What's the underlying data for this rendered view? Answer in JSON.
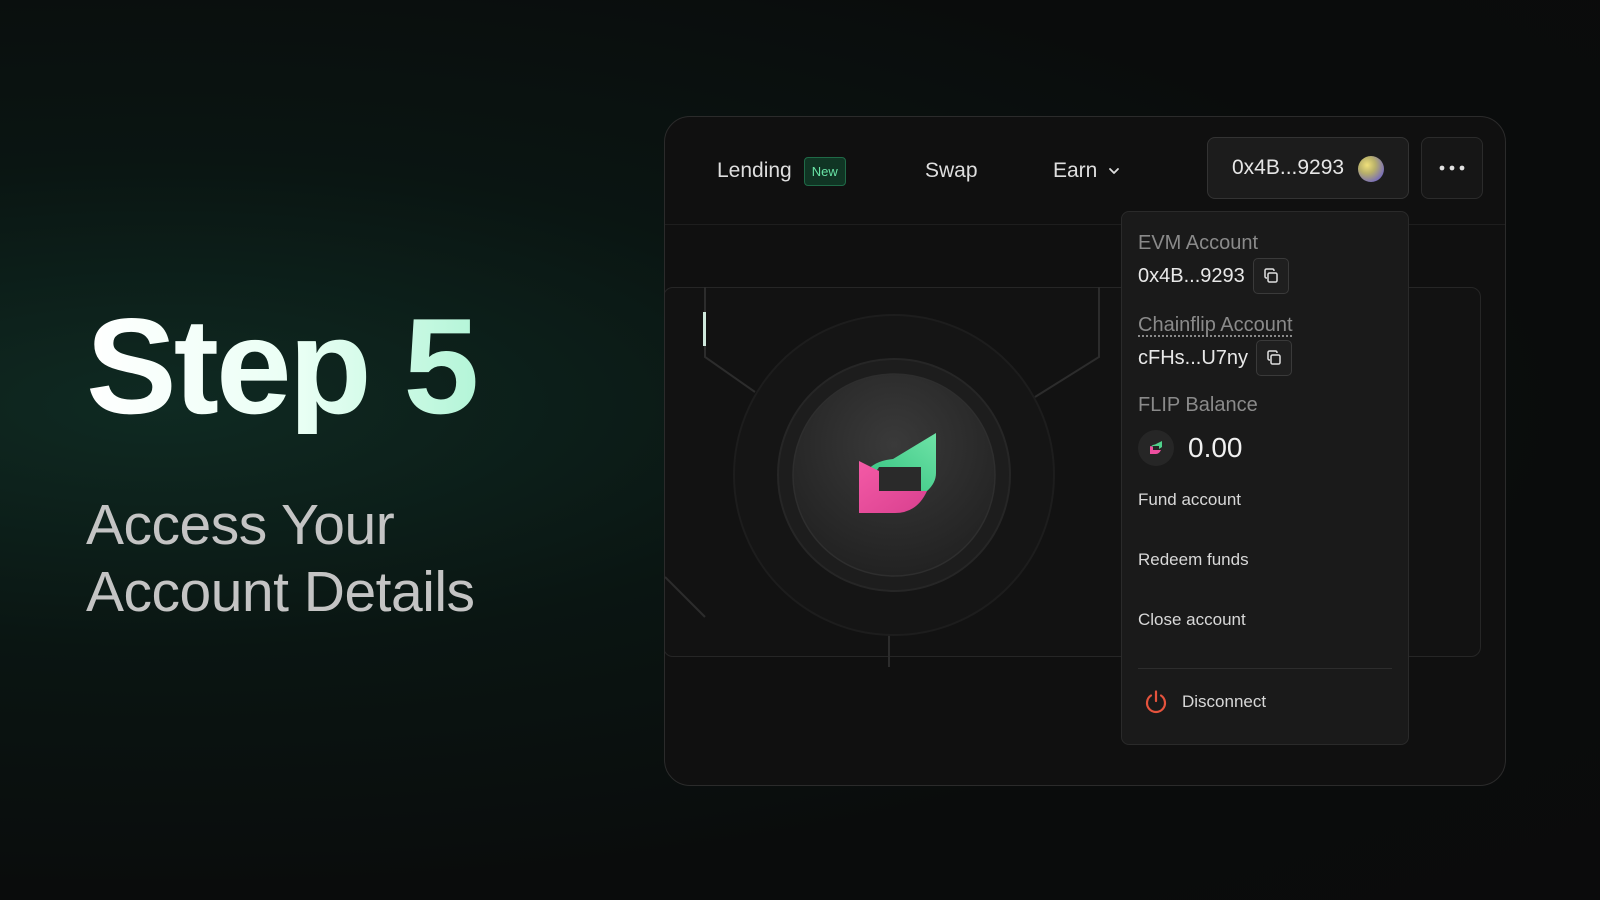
{
  "promo": {
    "title": "Step 5",
    "subtitle_line1": "Access Your",
    "subtitle_line2": "Account Details"
  },
  "nav": {
    "lending_label": "Lending",
    "lending_badge": "New",
    "swap_label": "Swap",
    "earn_label": "Earn"
  },
  "wallet": {
    "address": "0x4B...9293"
  },
  "dropdown": {
    "evm_label": "EVM Account",
    "evm_value": "0x4B...9293",
    "chainflip_label": "Chainflip Account",
    "chainflip_value": "cFHs...U7ny",
    "flip_label": "FLIP Balance",
    "flip_value": "0.00",
    "fund_account": "Fund account",
    "redeem_funds": "Redeem funds",
    "close_account": "Close account",
    "disconnect": "Disconnect"
  },
  "colors": {
    "accent_green": "#69e4a6",
    "flip_pink": "#ee4fa0",
    "flip_green": "#4fd18b",
    "disconnect_red": "#e5533d"
  },
  "icons": {
    "copy": "copy-icon",
    "more": "more-dots-icon",
    "chevron": "chevron-down-icon",
    "power": "power-icon",
    "logo": "chainflip-logo-icon"
  }
}
